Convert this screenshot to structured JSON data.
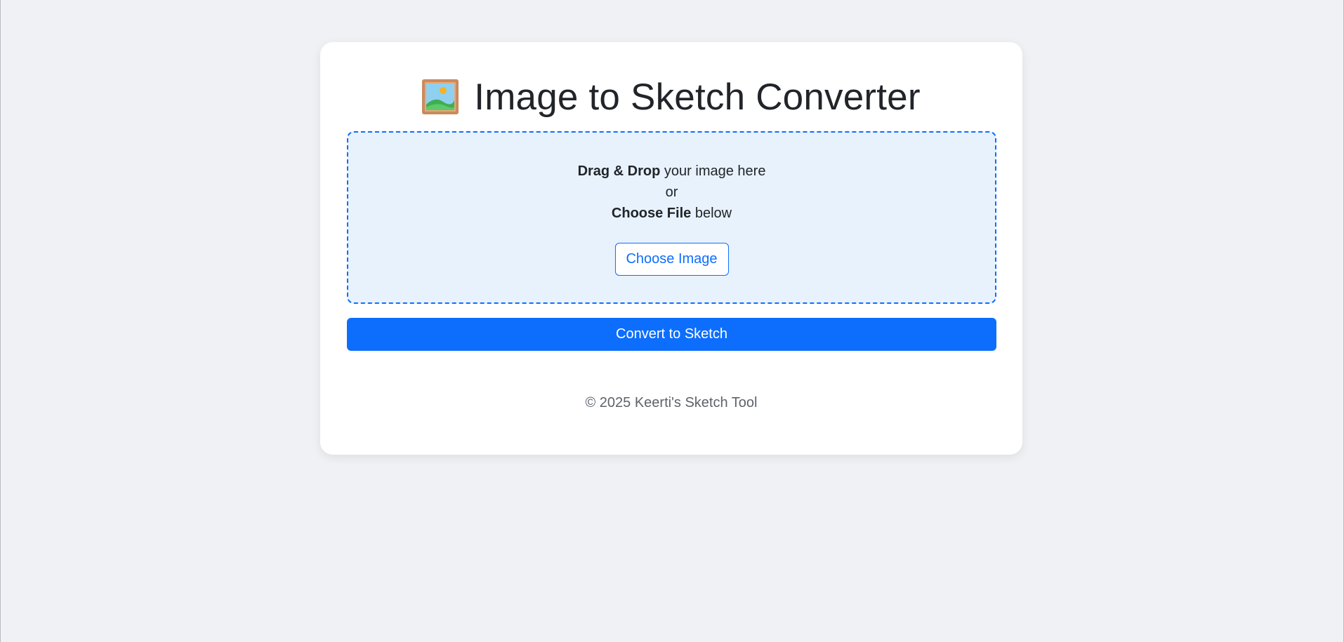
{
  "header": {
    "icon": "framed-picture-icon",
    "title": "Image to Sketch Converter"
  },
  "drop_zone": {
    "line1_bold": "Drag & Drop",
    "line1_rest": " your image here",
    "line2": "or",
    "line3_bold": "Choose File",
    "line3_rest": " below",
    "choose_button_label": "Choose Image"
  },
  "actions": {
    "convert_label": "Convert to Sketch"
  },
  "footer": {
    "text": "© 2025 Keerti's Sketch Tool"
  },
  "colors": {
    "accent": "#0d6efd",
    "drop_zone_bg": "#e8f2fd",
    "page_bg": "#eff1f5"
  }
}
